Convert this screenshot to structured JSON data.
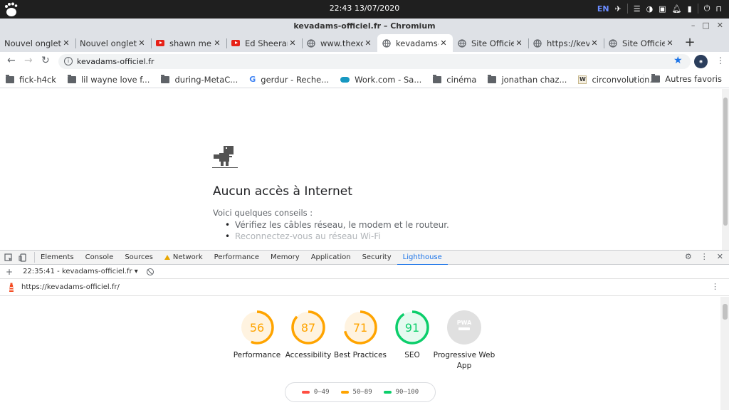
{
  "system": {
    "clock": "22:43 13/07/2020",
    "lang": "EN"
  },
  "window": {
    "title": "kevadams-officiel.fr – Chromium"
  },
  "tabs": [
    {
      "title": "Nouvel onglet",
      "icon": "none"
    },
    {
      "title": "Nouvel onglet",
      "icon": "none"
    },
    {
      "title": "shawn mendes",
      "icon": "youtube-icon"
    },
    {
      "title": "Ed Sheeran",
      "icon": "youtube-icon"
    },
    {
      "title": "www.thexc",
      "icon": "globe-icon"
    },
    {
      "title": "kevadams-o",
      "icon": "globe-icon",
      "active": true
    },
    {
      "title": "Site Officiel",
      "icon": "globe-icon"
    },
    {
      "title": "https://kev",
      "icon": "globe-icon"
    },
    {
      "title": "Site Officiel",
      "icon": "globe-icon"
    }
  ],
  "omnibox": {
    "url": "kevadams-officiel.fr"
  },
  "bookmarks": [
    {
      "label": "fick-h4ck",
      "icon": "folder-icon"
    },
    {
      "label": "lil wayne love f...",
      "icon": "folder-icon"
    },
    {
      "label": "during-MetaC...",
      "icon": "folder-icon"
    },
    {
      "label": "gerdur - Reche...",
      "icon": "google-icon"
    },
    {
      "label": "Work.com - Sa...",
      "icon": "salesforce-icon"
    },
    {
      "label": "cinéma",
      "icon": "folder-icon"
    },
    {
      "label": "jonathan chaz...",
      "icon": "folder-icon"
    },
    {
      "label": "circonvolution...",
      "icon": "w-icon"
    }
  ],
  "bookmarks_more": "»",
  "bookmarks_other": "Autres favoris",
  "error_page": {
    "title": "Aucun accès à Internet",
    "tips_label": "Voici quelques conseils :",
    "tips": [
      "Vérifiez les câbles réseau, le modem et le routeur.",
      "Reconnectez-vous au réseau Wi-Fi"
    ]
  },
  "devtools": {
    "tabs": [
      "Elements",
      "Console",
      "Sources",
      "Network",
      "Performance",
      "Memory",
      "Application",
      "Security",
      "Lighthouse"
    ],
    "active_tab": "Lighthouse",
    "report_select": "22:35:41 - kevadams-officiel.fr",
    "report_url": "https://kevadams-officiel.fr/"
  },
  "lighthouse": {
    "scores": [
      {
        "label": "Performance",
        "value": 56,
        "color": "#ffa400",
        "bg": "#fff3e0"
      },
      {
        "label": "Accessibility",
        "value": 87,
        "color": "#ffa400",
        "bg": "#fff3e0"
      },
      {
        "label": "Best Practices",
        "value": 71,
        "color": "#ffa400",
        "bg": "#fff3e0"
      },
      {
        "label": "SEO",
        "value": 91,
        "color": "#0cce6b",
        "bg": "#e6faf0"
      }
    ],
    "pwa": {
      "label": "Progressive Web App",
      "badge": "PWA"
    },
    "legend": [
      {
        "range": "0–49",
        "color": "#ff4e42"
      },
      {
        "range": "50–89",
        "color": "#ffa400"
      },
      {
        "range": "90–100",
        "color": "#0cce6b"
      }
    ]
  }
}
